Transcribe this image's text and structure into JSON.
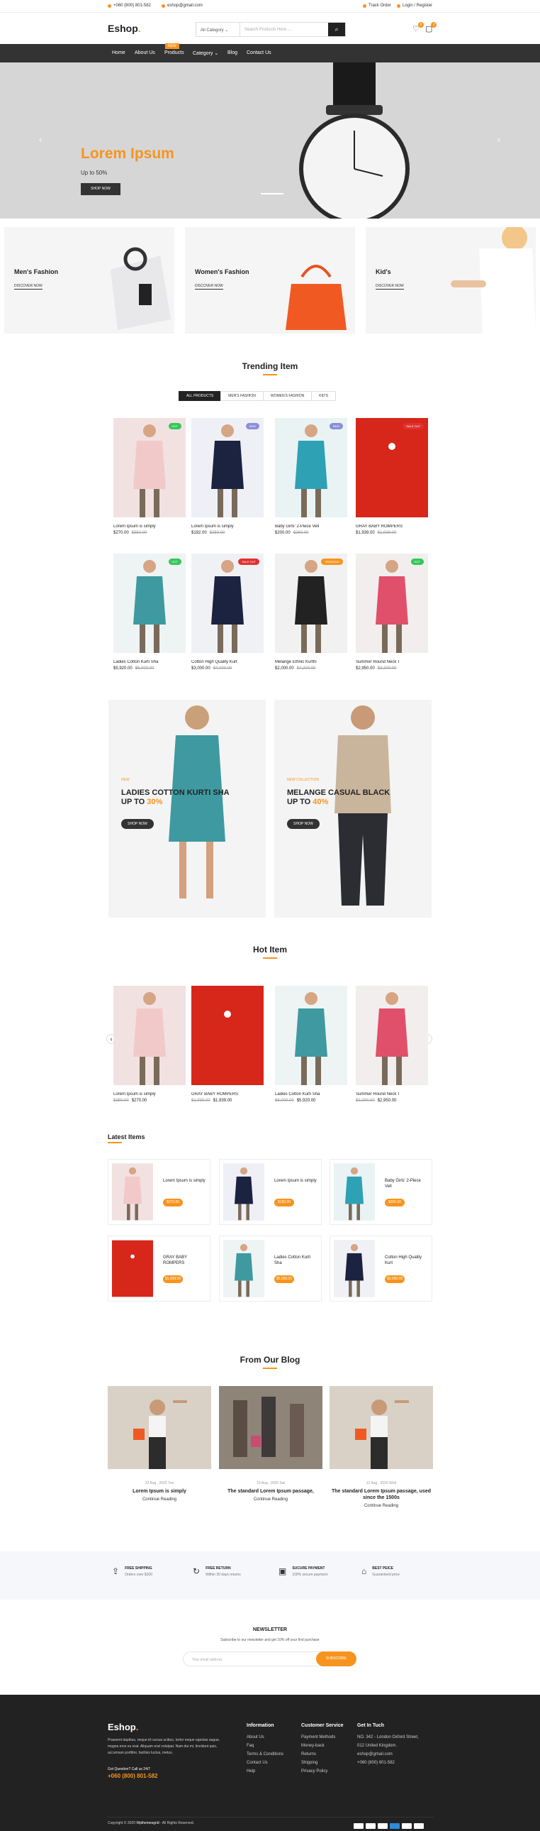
{
  "topbar": {
    "phone": "+060 (800) 801-582",
    "email": "eshop@gmail.com",
    "track": "Track Order",
    "login": "Login / Register"
  },
  "header": {
    "logo": "Eshop",
    "logo_dot": ".",
    "category": "All Category",
    "search_placeholder": "Search Products Here.....",
    "wishlist_count": "2",
    "cart_count": "2"
  },
  "nav": {
    "items": [
      "Home",
      "About Us",
      "Products",
      "Category",
      "Blog",
      "Contact Us"
    ],
    "new_badge": "NEW"
  },
  "hero": {
    "title": "Lorem Ipsum",
    "subtitle": "Up to 50%",
    "button": "SHOP NOW"
  },
  "categories": [
    {
      "title": "Men's Fashion",
      "link": "DISCOVER NOW"
    },
    {
      "title": "Women's Fashion",
      "link": "DISCOVER NOW"
    },
    {
      "title": "Kid's",
      "link": "DISCOVER NOW"
    }
  ],
  "trending": {
    "title": "Trending Item",
    "tabs": [
      "ALL PRODUCTS",
      "MEN'S FASHION",
      "WOMEN'S FASHION",
      "KID'S"
    ],
    "products": [
      {
        "name": "Lorem Ipsum is simply",
        "price": "$270.00",
        "old": "$350.00",
        "tag": "HOT",
        "tag_color": "#34c759",
        "bg": "#f2e1e1"
      },
      {
        "name": "Lorem Ipsum is simply",
        "price": "$192.00",
        "old": "$250.00",
        "tag": "NEW",
        "tag_color": "#8a8fd6",
        "bg": "#eef0f6"
      },
      {
        "name": "Baby Girls' 2-Piece Vell",
        "price": "$200.00",
        "old": "$260.00",
        "tag": "NEW",
        "tag_color": "#8a8fd6",
        "bg": "#e9f3f4"
      },
      {
        "name": "GRAY BABY ROMPERS",
        "price": "$1,939.00",
        "old": "$1,939.00",
        "tag": "SALE OUT",
        "tag_color": "#e03131",
        "bg": "#d7261a"
      },
      {
        "name": "Ladies Cotton Kurti Sha",
        "price": "$5,920.00",
        "old": "$6,000.00",
        "tag": "HOT",
        "tag_color": "#34c759",
        "bg": "#eef3f3"
      },
      {
        "name": "Cotton High Quality Kurt",
        "price": "$3,000.00",
        "old": "$4,000.00",
        "tag": "SALE OUT",
        "tag_color": "#e03131",
        "bg": "#f0f1f5"
      },
      {
        "name": "Melange Ethnic Kurthi",
        "price": "$2,000.00",
        "old": "$4,200.00",
        "tag": "TRENDING",
        "tag_color": "#f7941d",
        "bg": "#f1f1f1"
      },
      {
        "name": "Summer Round Neck T",
        "price": "$2,950.00",
        "old": "$3,200.00",
        "tag": "HOT",
        "tag_color": "#34c759",
        "bg": "#f2eeee"
      }
    ]
  },
  "banners": [
    {
      "pre": "NEW",
      "title": "LADIES COTTON KURTI SHA",
      "title2": "UP TO ",
      "pct": "30%",
      "button": "SHOP NOW"
    },
    {
      "pre": "NEW COLLECTION",
      "title": "MELANGE CASUAL BLACK",
      "title2": "UP TO ",
      "pct": "40%",
      "button": "SHOP NOW"
    }
  ],
  "hot": {
    "title": "Hot Item",
    "products": [
      {
        "name": "Lorem Ipsum is simply",
        "old": "$350.00",
        "price": "$270.00",
        "bg": "#f2e1e1"
      },
      {
        "name": "GRAY BABY ROMPERS",
        "old": "$1,939.00",
        "price": "$1,939.00",
        "bg": "#d7261a"
      },
      {
        "name": "Ladies Cotton Kurti Sha",
        "old": "$6,000.00",
        "price": "$5,920.00",
        "bg": "#eef3f3"
      },
      {
        "name": "Summer Round Neck T",
        "old": "$3,200.00",
        "price": "$2,950.00",
        "bg": "#f2eeee"
      }
    ]
  },
  "latest": {
    "title": "Latest Items",
    "items": [
      {
        "name": "Lorem Ipsum is simply",
        "price": "$270.00",
        "bg": "#f2e1e1"
      },
      {
        "name": "Lorem Ipsum is simply",
        "price": "$192.00",
        "bg": "#eef0f6"
      },
      {
        "name": "Baby Girls' 2-Piece Vell",
        "price": "$200.00",
        "bg": "#e9f3f4"
      },
      {
        "name": "GRAY BABY ROMPERS",
        "price": "$1,939.00",
        "bg": "#d7261a"
      },
      {
        "name": "Ladies Cotton Kurti Sha",
        "price": "$5,920.00",
        "bg": "#eef3f3"
      },
      {
        "name": "Cotton High Quality Kurt",
        "price": "$3,000.00",
        "bg": "#f0f1f5"
      }
    ]
  },
  "blog": {
    "title": "From Our Blog",
    "posts": [
      {
        "date": "22 Aug , 2020 Tue",
        "title": "Lorem Ipsum is simply",
        "cta": "Continue Reading"
      },
      {
        "date": "15 Aug , 2020 Sat",
        "title": "The standard Lorem Ipsum passage,",
        "cta": "Continue Reading"
      },
      {
        "date": "12 Aug , 2020 Wed",
        "title": "The standard Lorem Ipsum passage, used since the 1500s",
        "cta": "Continue Reading"
      }
    ]
  },
  "services": [
    {
      "title": "FREE SHIPPING",
      "sub": "Orders over $100"
    },
    {
      "title": "FREE RETURN",
      "sub": "Within 30 days returns"
    },
    {
      "title": "SUCURE PAYMENT",
      "sub": "100% secure payment"
    },
    {
      "title": "BEST PEICE",
      "sub": "Guaranteed price"
    }
  ],
  "newsletter": {
    "title": "NEWSLETTER",
    "text": "Subscribe to our newsletter and get 10% off your first purchase",
    "placeholder": "Your email address",
    "button": "SUBSCRIBE"
  },
  "footer": {
    "logo": "Eshop",
    "logo_dot": ".",
    "about": "Praesent dapibus, neque id cursus ucibus, tortor neque egestas augue, magna eros eu erat. Aliquam erat volutpat. Nam dui mi, tincidunt quis, accumsan porttitor, facilisis luctus, metus.",
    "question": "Got Question? Call us 24/7",
    "phone": "+060 (800) 801-582",
    "info_title": "Information",
    "info": [
      "About Us",
      "Faq",
      "Terms & Conditions",
      "Contact Us",
      "Help"
    ],
    "cs_title": "Customer Service",
    "cs": [
      "Payment Methods",
      "Money-back",
      "Returns",
      "Shipping",
      "Privacy Policy"
    ],
    "touch_title": "Get In Tuch",
    "address1": "NO. 342 - London Oxford Street,",
    "address2": "012 United Kingdom.",
    "email": "eshop@gmail.com",
    "tphone": "+060 (800) 801-582",
    "copyright": "Copyright © 2020 ",
    "brand": "Wpthemesgrid",
    "rights": " - All Rights Reserved."
  }
}
